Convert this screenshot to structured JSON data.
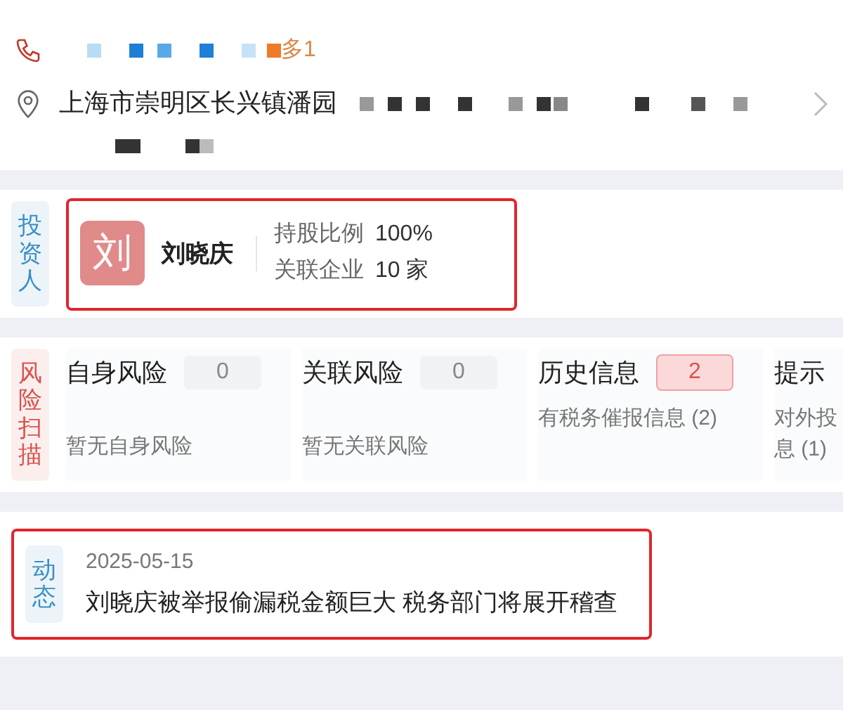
{
  "contact": {
    "phone_extra": "多1",
    "address": "上海市崇明区长兴镇潘园"
  },
  "investor": {
    "tag": "投资人",
    "color": "#3a8fc4",
    "avatar": "刘",
    "name": "刘晓庆",
    "stats": [
      {
        "label": "持股比例",
        "value": "100%"
      },
      {
        "label": "关联企业",
        "value": "10 家"
      }
    ]
  },
  "risk": {
    "tag": "风险扫描",
    "color": "#d9534f",
    "cards": [
      {
        "title": "自身风险",
        "count": "0",
        "alert": false,
        "lines": [
          "暂无自身风险"
        ]
      },
      {
        "title": "关联风险",
        "count": "0",
        "alert": false,
        "lines": [
          "暂无关联风险"
        ]
      },
      {
        "title": "历史信息",
        "count": "2",
        "alert": true,
        "lines": [
          "有税务催报信息 (2)"
        ]
      },
      {
        "title": "提示",
        "lines": [
          "对外投",
          "息 (1)"
        ]
      }
    ]
  },
  "news": {
    "tag": "动态",
    "color": "#3a8fc4",
    "date": "2025-05-15",
    "headline": "刘晓庆被举报偷漏税金额巨大 税务部门将展开稽查"
  }
}
